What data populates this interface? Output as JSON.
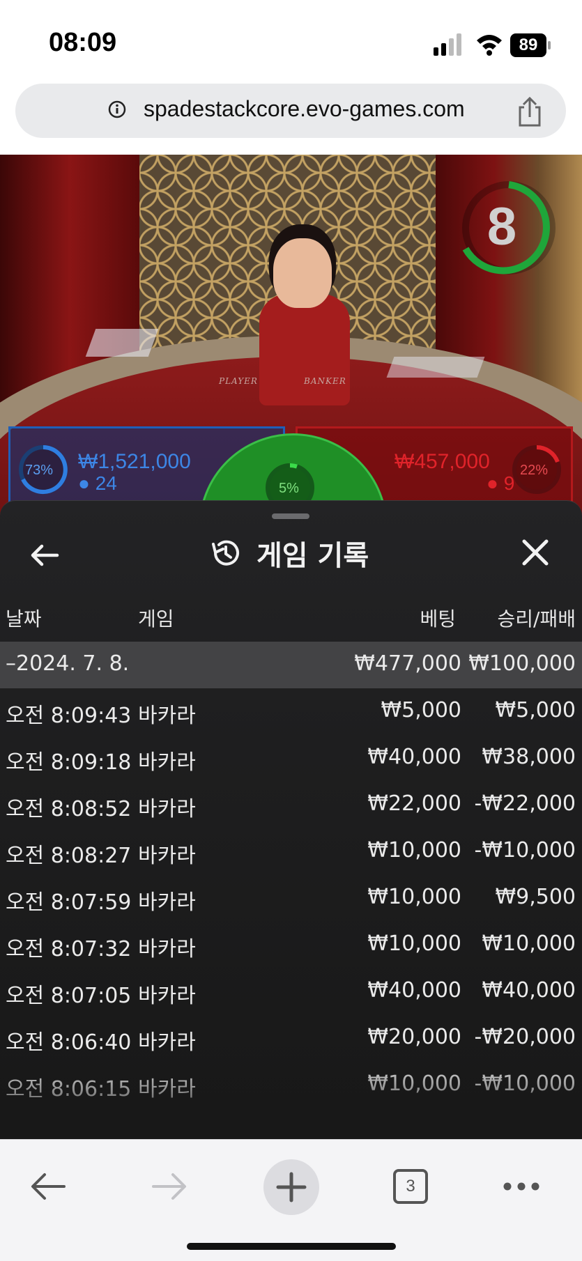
{
  "status_bar": {
    "time": "08:09",
    "battery": "89"
  },
  "browser": {
    "url": "spadestackcore.evo-games.com",
    "tab_count": "3"
  },
  "game": {
    "timer": "8",
    "table_labels": {
      "player": "PLAYER",
      "banker": "BANKER"
    },
    "player": {
      "percent": "73%",
      "amount": "₩1,521,000",
      "players": "24"
    },
    "tie": {
      "percent": "5%"
    },
    "banker": {
      "percent": "22%",
      "amount": "₩457,000",
      "players": "9"
    }
  },
  "history": {
    "title": "게임 기록",
    "columns": {
      "date": "날짜",
      "game": "게임",
      "bet": "베팅",
      "result": "승리/패배"
    },
    "summary": {
      "date": "–2024. 7. 8.",
      "bet": "₩477,000",
      "result": "₩100,000"
    },
    "rows": [
      {
        "time": "오전 8:09:43",
        "game": "바카라",
        "bet": "₩5,000",
        "result": "₩5,000"
      },
      {
        "time": "오전 8:09:18",
        "game": "바카라",
        "bet": "₩40,000",
        "result": "₩38,000"
      },
      {
        "time": "오전 8:08:52",
        "game": "바카라",
        "bet": "₩22,000",
        "result": "-₩22,000"
      },
      {
        "time": "오전 8:08:27",
        "game": "바카라",
        "bet": "₩10,000",
        "result": "-₩10,000"
      },
      {
        "time": "오전 8:07:59",
        "game": "바카라",
        "bet": "₩10,000",
        "result": "₩9,500"
      },
      {
        "time": "오전 8:07:32",
        "game": "바카라",
        "bet": "₩10,000",
        "result": "₩10,000"
      },
      {
        "time": "오전 8:07:05",
        "game": "바카라",
        "bet": "₩40,000",
        "result": "₩40,000"
      },
      {
        "time": "오전 8:06:40",
        "game": "바카라",
        "bet": "₩20,000",
        "result": "-₩20,000"
      },
      {
        "time": "오전 8:06:15",
        "game": "바카라",
        "bet": "₩10,000",
        "result": "-₩10,000"
      }
    ]
  }
}
